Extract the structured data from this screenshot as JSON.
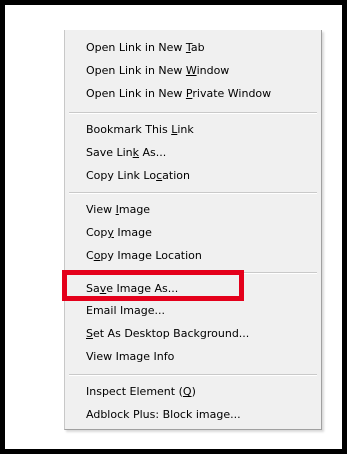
{
  "highlight_color": "#e4001b",
  "menu": {
    "items": [
      {
        "pre": "Open Link in New ",
        "key": "T",
        "post": "ab"
      },
      {
        "pre": "Open Link in New ",
        "key": "W",
        "post": "indow"
      },
      {
        "pre": "Open Link in New ",
        "key": "P",
        "post": "rivate Window"
      },
      {
        "pre": "Bookmark This ",
        "key": "L",
        "post": "ink"
      },
      {
        "pre": "Save Lin",
        "key": "k",
        "post": " As..."
      },
      {
        "pre": "Copy Link Lo",
        "key": "c",
        "post": "ation"
      },
      {
        "pre": "View ",
        "key": "I",
        "post": "mage"
      },
      {
        "pre": "Cop",
        "key": "y",
        "post": " Image"
      },
      {
        "pre": "C",
        "key": "o",
        "post": "py Image Location"
      },
      {
        "pre": "Sa",
        "key": "v",
        "post": "e Image As..."
      },
      {
        "pre": "Email Image...",
        "key": "",
        "post": ""
      },
      {
        "pre": "",
        "key": "S",
        "post": "et As Desktop Background..."
      },
      {
        "pre": "View Image Info",
        "key": "",
        "post": ""
      },
      {
        "pre": "Inspect Element (",
        "key": "Q",
        "post": ")"
      },
      {
        "pre": "Adblock Plus: Block image...",
        "key": "",
        "post": ""
      }
    ]
  }
}
